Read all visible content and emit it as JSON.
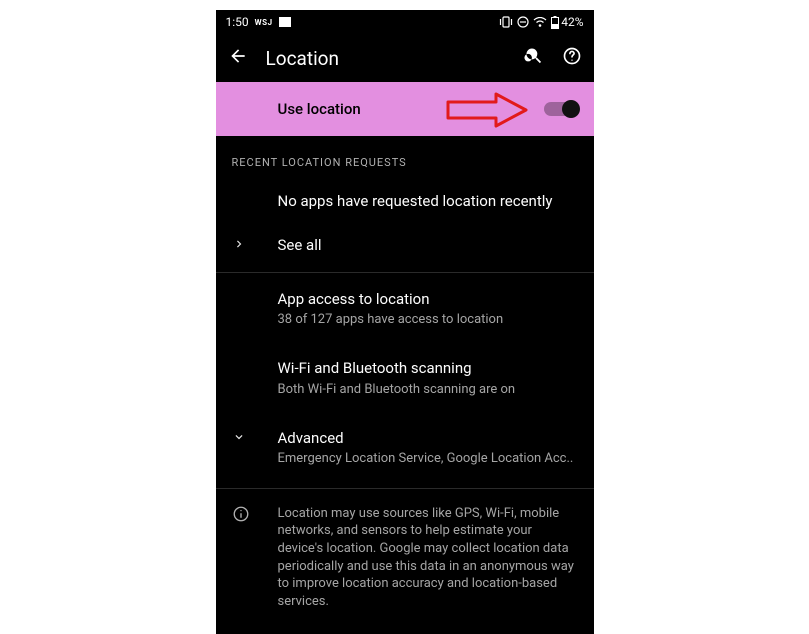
{
  "statusbar": {
    "time": "1:50",
    "wsj": "WSJ",
    "battery": "42%"
  },
  "topbar": {
    "title": "Location"
  },
  "use_location": {
    "label": "Use location"
  },
  "section_recent": "Recent Location Requests",
  "recent_empty": "No apps have requested location recently",
  "see_all": "See all",
  "app_access": {
    "title": "App access to location",
    "sub": "38 of 127 apps have access to location"
  },
  "wifi_bt": {
    "title": "Wi-Fi and Bluetooth scanning",
    "sub": "Both Wi-Fi and Bluetooth scanning are on"
  },
  "advanced": {
    "title": "Advanced",
    "sub": "Emergency Location Service, Google Location Acc.."
  },
  "info": "Location may use sources like GPS, Wi-Fi, mobile networks, and sensors to help estimate your device's location. Google may collect location data periodically and use this data in an anonymous way to improve location accuracy and location-based services."
}
